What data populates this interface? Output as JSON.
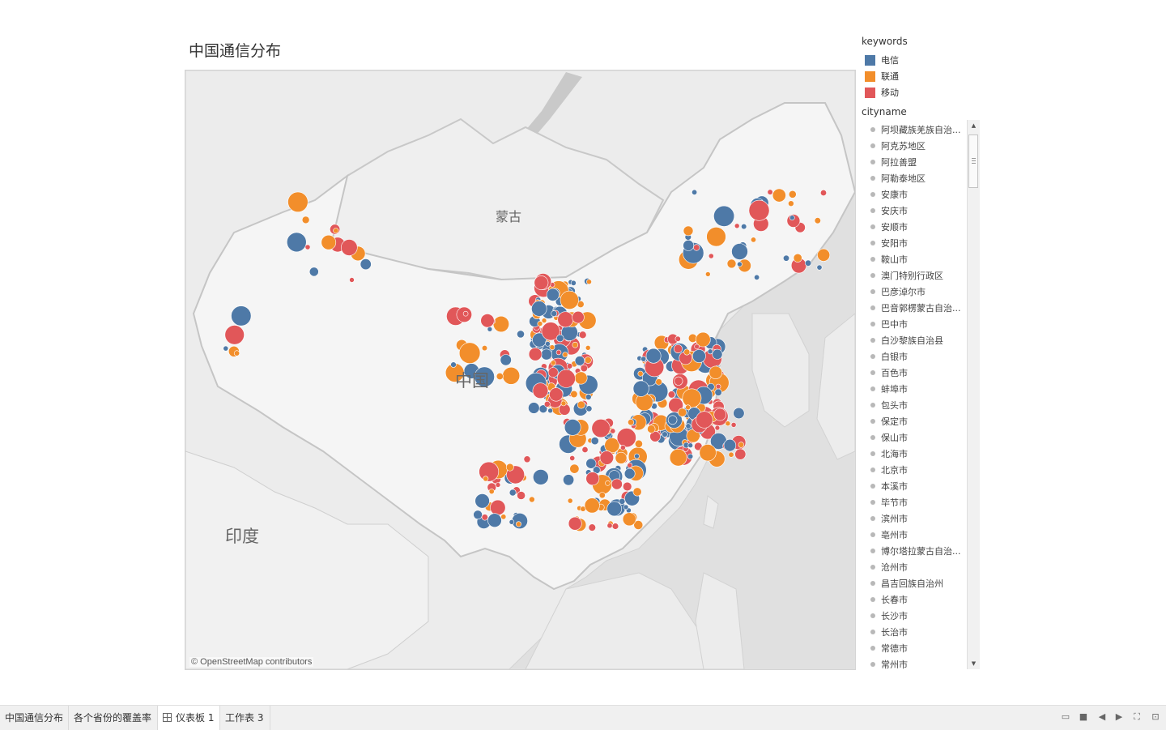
{
  "dashboard": {
    "title": "中国通信分布",
    "attribution": "© OpenStreetMap contributors",
    "map_labels": {
      "mongolia": "蒙古",
      "china": "中国",
      "india": "印度"
    }
  },
  "legend": {
    "title": "keywords",
    "items": [
      {
        "label": "电信",
        "color": "#4e79a7"
      },
      {
        "label": "联通",
        "color": "#f28e2b"
      },
      {
        "label": "移动",
        "color": "#e15759"
      }
    ]
  },
  "city_filter": {
    "title": "cityname",
    "items": [
      "阿坝藏族羌族自治...",
      "阿克苏地区",
      "阿拉善盟",
      "阿勒泰地区",
      "安康市",
      "安庆市",
      "安顺市",
      "安阳市",
      "鞍山市",
      "澳门特别行政区",
      "巴彦淖尔市",
      "巴音郭楞蒙古自治...",
      "巴中市",
      "白沙黎族自治县",
      "白银市",
      "百色市",
      "蚌埠市",
      "包头市",
      "保定市",
      "保山市",
      "北海市",
      "北京市",
      "本溪市",
      "毕节市",
      "滨州市",
      "亳州市",
      "博尔塔拉蒙古自治...",
      "沧州市",
      "昌吉回族自治州",
      "长春市",
      "长沙市",
      "长治市",
      "常德市",
      "常州市"
    ]
  },
  "tabs": [
    {
      "label": "中国通信分布",
      "active": false,
      "icon": ""
    },
    {
      "label": "各个省份的覆盖率",
      "active": false,
      "icon": ""
    },
    {
      "label": "仪表板 1",
      "active": true,
      "icon": "dashboard-grid-icon"
    },
    {
      "label": "工作表 3",
      "active": false,
      "icon": ""
    }
  ],
  "nav_icons": [
    "sheet-sorter-icon",
    "filmstrip-icon",
    "prev-sheet-icon",
    "next-sheet-icon",
    "fullscreen-icon",
    "presentation-icon"
  ]
}
